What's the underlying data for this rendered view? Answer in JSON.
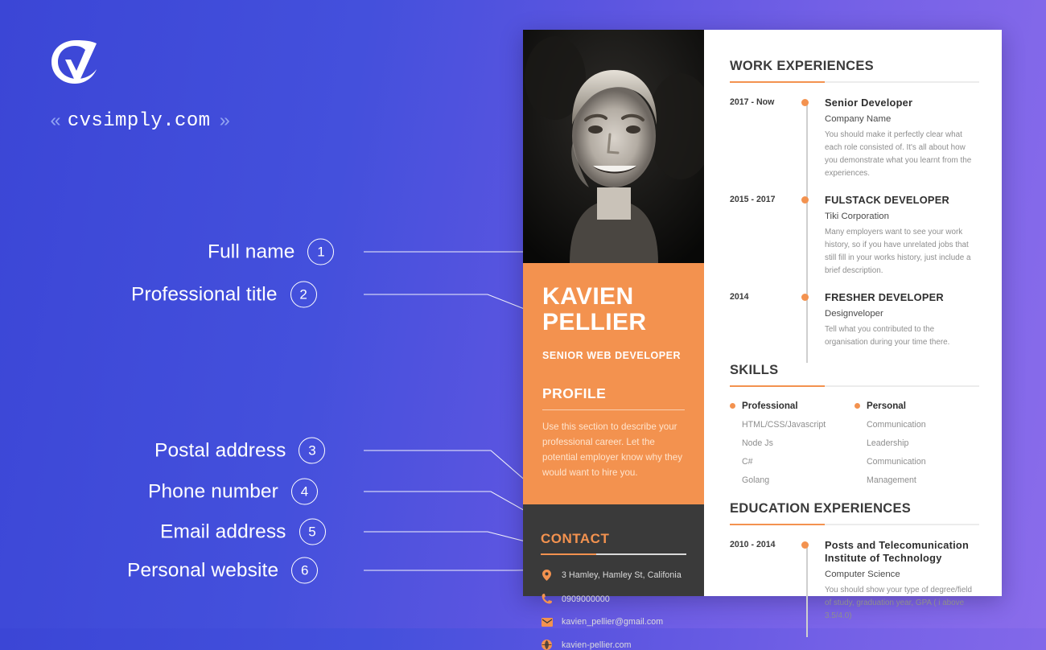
{
  "brand": {
    "name": "cvsimply.com",
    "chevron_left": "«",
    "chevron_right": "»",
    "logo_icon": "cv-checkmark-logo"
  },
  "annotations": [
    {
      "number": "①",
      "label": "Full name"
    },
    {
      "number": "②",
      "label": "Professional title"
    },
    {
      "number": "③",
      "label": "Postal address"
    },
    {
      "number": "④",
      "label": "Phone number"
    },
    {
      "number": "⑤",
      "label": "Email address"
    },
    {
      "number": "⑥",
      "label": "Personal website"
    }
  ],
  "cv": {
    "full_name_line1": "KAVIEN",
    "full_name_line2": "PELLIER",
    "job_title": "SENIOR WEB DEVELOPER",
    "profile": {
      "heading": "PROFILE",
      "text": "Use this section to describe your professional career. Let the potential employer know why they would want to hire you."
    },
    "contact": {
      "heading": "CONTACT",
      "items": [
        {
          "icon": "map-pin-icon",
          "value": "3 Hamley, Hamley St, Califonia"
        },
        {
          "icon": "phone-icon",
          "value": "0909000000"
        },
        {
          "icon": "envelope-icon",
          "value": "kavien_pellier@gmail.com"
        },
        {
          "icon": "globe-icon",
          "value": "kavien-pellier.com"
        }
      ]
    },
    "work": {
      "heading": "WORK EXPERIENCES",
      "entries": [
        {
          "date": "2017 - Now",
          "role": "Senior Developer",
          "org": "Company Name",
          "desc": "You should make it perfectly clear what each role consisted of. It's all about how you demonstrate what you learnt from the experiences."
        },
        {
          "date": "2015 - 2017",
          "role": "FULSTACK DEVELOPER",
          "org": "Tiki Corporation",
          "desc": "Many employers want to see your work history, so if you have unrelated jobs that still fill in your works history, just include a brief description."
        },
        {
          "date": "2014",
          "role": "FRESHER DEVELOPER",
          "org": "Designveloper",
          "desc": "Tell what you contributed to the organisation during your time there."
        }
      ]
    },
    "skills": {
      "heading": "SKILLS",
      "columns": [
        {
          "title": "Professional",
          "items": [
            "HTML/CSS/Javascript",
            "Node Js",
            "C#",
            "Golang"
          ]
        },
        {
          "title": "Personal",
          "items": [
            "Communication",
            "Leadership",
            "Communication",
            "Management"
          ]
        }
      ]
    },
    "education": {
      "heading": "EDUCATION EXPERIENCES",
      "entries": [
        {
          "date": "2010 - 2014",
          "role": "Posts and Telecomunication Institute of Technology",
          "org": "Computer Science",
          "desc": "You should show your type of degree/field of study, graduation year, GPA ( i above 3.5/4.0)"
        }
      ]
    }
  },
  "colors": {
    "accent_orange": "#f3924f",
    "sidebar_dark": "#3a3a3a",
    "bg_blue": "#3b46d6",
    "bg_purple": "#8a6ceb"
  }
}
